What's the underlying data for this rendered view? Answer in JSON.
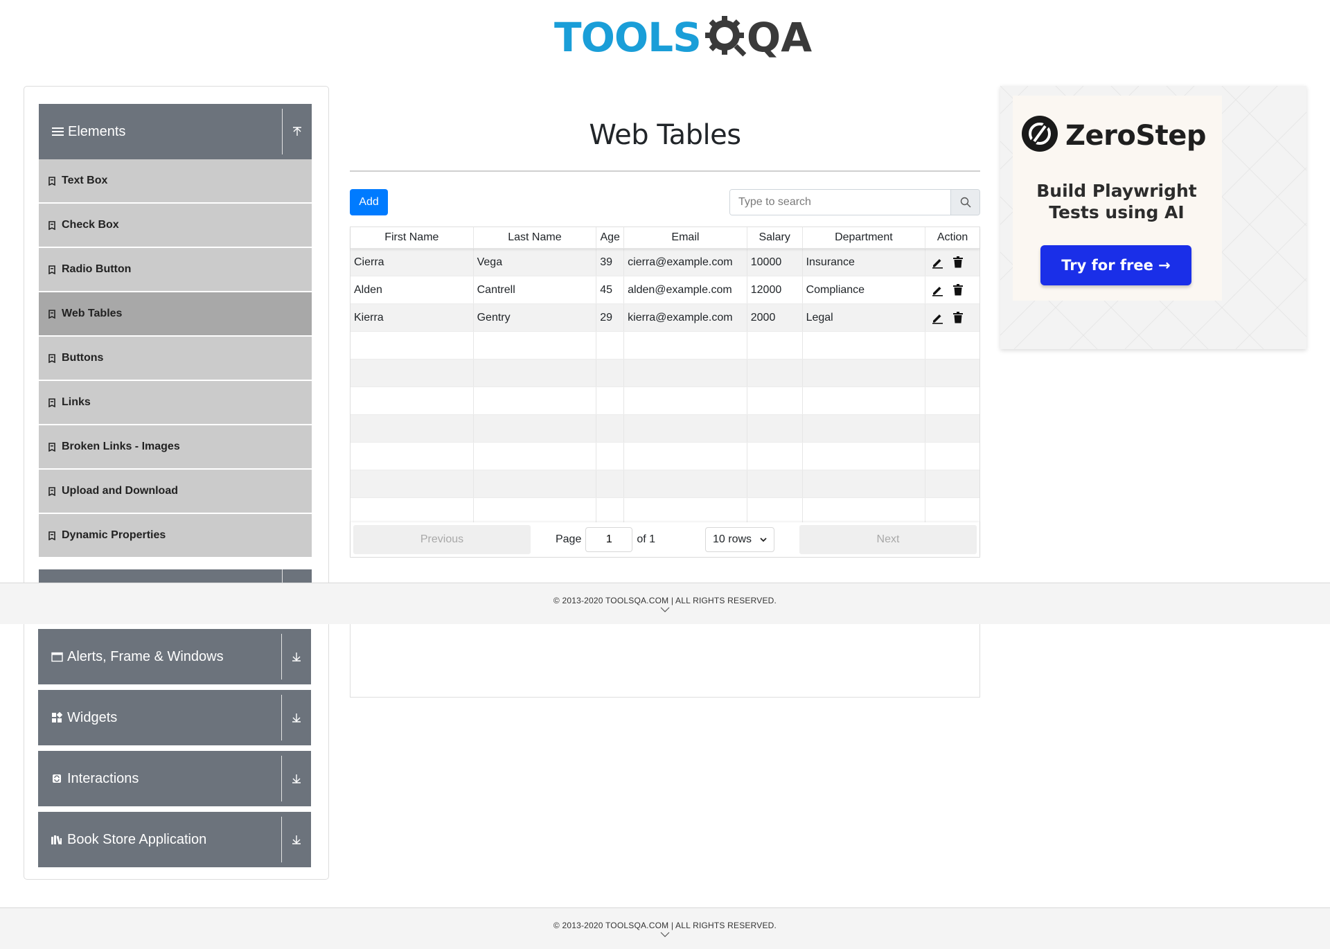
{
  "logo": {
    "text_tools": "TOOLS",
    "text_qa": "QA"
  },
  "page": {
    "title": "Web Tables"
  },
  "sidebar": {
    "groups_top": [
      {
        "label": "Elements",
        "icon": "hamburger-icon",
        "toggle_icon": "collapse-arrow-icon"
      }
    ],
    "items": [
      {
        "label": "Text Box",
        "active": false
      },
      {
        "label": "Check Box",
        "active": false
      },
      {
        "label": "Radio Button",
        "active": false
      },
      {
        "label": "Web Tables",
        "active": true
      },
      {
        "label": "Buttons",
        "active": false
      },
      {
        "label": "Links",
        "active": false
      },
      {
        "label": "Broken Links - Images",
        "active": false
      },
      {
        "label": "Upload and Download",
        "active": false
      },
      {
        "label": "Dynamic Properties",
        "active": false
      }
    ],
    "groups_bottom": [
      {
        "label": "Alerts, Frame & Windows",
        "icon": "window-icon",
        "toggle_icon": "expand-arrow-icon"
      },
      {
        "label": "Widgets",
        "icon": "widgets-icon",
        "toggle_icon": "expand-arrow-icon"
      },
      {
        "label": "Interactions",
        "icon": "interactions-icon",
        "toggle_icon": "expand-arrow-icon"
      },
      {
        "label": "Book Store Application",
        "icon": "books-icon",
        "toggle_icon": "expand-arrow-icon"
      }
    ]
  },
  "toolbar": {
    "add_label": "Add",
    "search_placeholder": "Type to search",
    "search_value": ""
  },
  "table": {
    "columns": [
      "First Name",
      "Last Name",
      "Age",
      "Email",
      "Salary",
      "Department",
      "Action"
    ],
    "rows": [
      {
        "first": "Cierra",
        "last": "Vega",
        "age": "39",
        "email": "cierra@example.com",
        "salary": "10000",
        "department": "Insurance"
      },
      {
        "first": "Alden",
        "last": "Cantrell",
        "age": "45",
        "email": "alden@example.com",
        "salary": "12000",
        "department": "Compliance"
      },
      {
        "first": "Kierra",
        "last": "Gentry",
        "age": "29",
        "email": "kierra@example.com",
        "salary": "2000",
        "department": "Legal"
      }
    ],
    "empty_rows": 7
  },
  "pagination": {
    "previous_label": "Previous",
    "next_label": "Next",
    "page_label": "Page",
    "page_value": "1",
    "of_label": "of 1",
    "rows_value": "10 rows"
  },
  "footer": {
    "copyright": "© 2013-2020 TOOLSQA.COM | ALL RIGHTS RESERVED."
  },
  "ad": {
    "brand": "ZeroStep",
    "tagline_line1": "Build Playwright",
    "tagline_line2": "Tests using AI",
    "cta": "Try for free →",
    "cta_color": "#1a2fe8"
  },
  "colors": {
    "primary": "#007bff",
    "sidebar_group": "#6c737c",
    "sidebar_item": "#cbcbcb",
    "sidebar_item_active": "#a8a8a8",
    "logo_blue": "#1a9ed8"
  }
}
